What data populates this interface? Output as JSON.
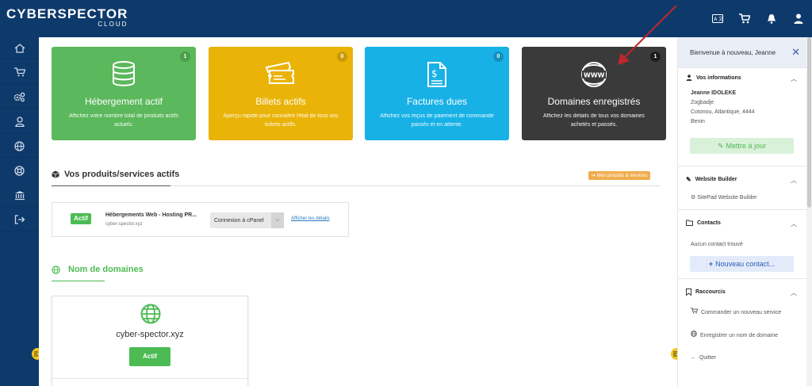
{
  "brand": {
    "name": "CYBERSPECTOR",
    "sub": "CLOUD"
  },
  "topbar_icons": [
    "translate-icon",
    "cart-icon",
    "bell-icon",
    "user-icon"
  ],
  "leftnav": [
    "home-icon",
    "cart-icon",
    "gears-icon",
    "user-icon",
    "globe-icon",
    "support-icon",
    "bank-icon",
    "logout-icon"
  ],
  "tiles": [
    {
      "title": "Hébergement actif",
      "desc": "Affichez votre nombre total de produits actifs actuels.",
      "badge": "1",
      "color": "#5cb85c",
      "badge_color": "#4aa04a"
    },
    {
      "title": "Billets actifs",
      "desc": "Aperçu rapide pour connaître l'état de tous vos tickets actifs.",
      "badge": "0",
      "color": "#eab308",
      "badge_color": "#c99a06"
    },
    {
      "title": "Factures dues",
      "desc": "Affichez vos reçus de paiement de commande passés et en attente.",
      "badge": "0",
      "color": "#17b1e6",
      "badge_color": "#1290bd"
    },
    {
      "title": "Domaines enregistrés",
      "desc": "Affichez les détails de tous vos domaines achetés et passés.",
      "badge": "1",
      "color": "#3a3a3a",
      "badge_color": "#1c1c1c"
    }
  ],
  "products_section": {
    "title": "Vos produits/services actifs",
    "link_label": "Mes produits & services",
    "item": {
      "status": "Actif",
      "name": "Hébergements Web - Hosting PR...",
      "domain": "cyber-spector.xyz",
      "action": "Connexion à cPanel",
      "details": "Afficher les détails"
    }
  },
  "domains_section": {
    "title": "Nom de domaines",
    "domain": "cyber-spector.xyz",
    "status": "Actif"
  },
  "right_panel": {
    "welcome": "Bienvenue à nouveau, Jeanne",
    "info": {
      "title": "Vos informations",
      "name": "Jeanne IDOLEKE",
      "lines": [
        "Zogbadje",
        "Cotonou, Atlantique, 4444",
        "Benin"
      ],
      "update_label": "Mettre à jour"
    },
    "website_builder": {
      "title": "Website Builder",
      "item": "SitePad Website Builder"
    },
    "contacts": {
      "title": "Contacts",
      "empty": "Aucun contact trouvé",
      "new_label": "Nouveau contact..."
    },
    "shortcuts": {
      "title": "Raccourcis",
      "items": [
        "Commander un nouveau service",
        "Enregistrer un nom de domaine",
        "Quitter"
      ]
    }
  }
}
